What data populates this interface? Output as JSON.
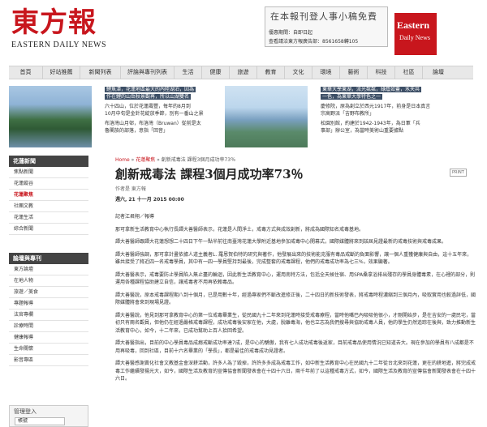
{
  "header": {
    "logo_cn": "東方報",
    "logo_en": "EASTERN DAILY NEWS",
    "ad_title": "在本報刊登人事小稿免費",
    "ad_line1": "優惠期間：自即日起",
    "ad_line2": "查看請洽東方報廣告部：8561658轉105",
    "badge_line1": "Eastern",
    "badge_line2": "Daily News"
  },
  "nav": [
    "首頁",
    "好站推薦",
    "新聞列表",
    "評論與專刊列表",
    "生活",
    "健康",
    "旅遊",
    "教育",
    "文化",
    "環境",
    "藝術",
    "科技",
    "社區",
    "論壇"
  ],
  "featured": [
    {
      "lines": [
        "鯉魚潭，花蓮地區最大的內陸湖泊，因為",
        "作在鯉的山岳秋景觀再，所以山湖雙名",
        "六十四山，位於花蓮壽豐，每年的8月到",
        "10月中旬是金針花綻放季節，別有一番山之景",
        "布洛灣山月邨，布洛灣（Bruwan）從前是太",
        "魯閣族的部落，意指「回音」"
      ]
    },
    {
      "lines": [
        "東華大學東湖，派光粼粼，綠蔭如蓋，水天共",
        "一色，為東華大學特色之一",
        "慶修院，原為創立於西元1917年，前身是日本真言",
        "宗高野派「吉野布教所」",
        "松園別館，約建於1942-1943年，為日軍「兵",
        "事部」辦公室，為當時美術山重要據點"
      ]
    }
  ],
  "sidebar": {
    "news_head": "花蓮新聞",
    "news_items": [
      "焦點新聞",
      "花蓮縱谷",
      "花蓮聚焦",
      "社團文教",
      "花蓮生活",
      "綜合新聞"
    ],
    "active_item": "花蓮聚焦",
    "column_head": "論壇與專刊",
    "column_items": [
      "東方論壇",
      "在地人物",
      "旅遊／美食",
      "專題報導",
      "法官專欄",
      "診療時間",
      "健康報導",
      "生命關懷",
      "影音專區"
    ],
    "login_title": "管理登入",
    "login_placeholder": "帳號"
  },
  "article": {
    "crumb_home": "Home",
    "crumb_sep1": "»",
    "crumb_section": "花蓮聚焦",
    "crumb_sep2": "»",
    "crumb_current": "創新戒毒法 課程3個月成功率73％",
    "title": "創新戒毒法 課程3個月成功率73％",
    "print_label": "PRINT",
    "author": "作者是 東方報",
    "date": "週六, 21 十一月 2015 00:00",
    "byline": "記者江君翔／報導",
    "paragraphs": [
      "那可拿新生活教育中心執行長譚大善醫師表示，花蓮是人間淨土，戒毒方式與成效創新，將成為國際知名戒毒基地。",
      "譚大善醫師跟譚大花蓮想想二十四日下午一點半前往南臺灣花蓮大學附近基地參加戒毒中心開幕式，國際媒體將來到該屆見證最新的戒毒技術與戒毒成果。",
      "譚大善醫師強調，那可拿計畫依據人道主義者L. 羅恩賀伯特的研究與著作，他發展出來的技術能克服有毒品戒斷的負面影響，讓一個人重獲健康與自由，這十五年來，雖共接受了將近四一名戒毒學員，其中有一四一學員堅持到最後，完成整套的戒毒課程，他們的戒毒成功率為七三%，效果顯著。",
      "譚大善醫表示，戒毒要防止學員陷入無止盡的輪迴，因此新生活教育中心，運用南特方法，包括全天候住宿、用SPA桑拿浴排出殘存的學員身體毒素，在心裡的部分，則運用各種課程協助建立自信，讓戒毒者不用再依賴毒品。",
      "譚大善醫說，原本戒毒課程期八到十個月，已是用數十年，經過專家們不斷改進修正後，二十四日的新技術發表，將戒毒時程濃縮到三個月內，吸取實用也較過詳低，國際媒體將會來到現場見證。",
      "譚大善醫說，他見到那可拿教育中心的第一位戒毒畢業生，從民國九十二年來到花蓮時接受戒毒療程，當時他嘴巴內吸吸他很小，才剛開始步，是在吉安的一處民宅，當初只有兩名觀員，但他仍在經過嚴格戒毒課程，成功戒毒後安家在他，大處，脫離毒海，他也立志為我們搜尋與協助戒毒人員，他的學生仍然追踪在後與，致力推動新生活教育中心，如今，十二年來，已成功幫助上百人拾回希望。",
      "譚大善醫指出，目前的中心學員毒品成癮戒斷成功率達7成，是中心的驕傲，我有七人成功戒毒後返家，目前戒毒品使用情況已知道去大。現在參加的學員有八成都是不用再吸毒，回到社區，目前十六名畢業的「學長」，都是最佳的戒毒成功見證者。",
      "譚大善醫感謝黃化社會文教基金會深耕活動，許多人為了毀掉，許許多多成為戒毒工作，如中新生活教育中心在民國九十二年從台北來到花蓮，更在的耕地進，將完成戒毒工作繼續發揚光大，如今，國際生活及教育的宣傳協會新聞發表會在十四十六日，兩千年前了以這種戒毒方式，如今，國際生活及教育的宣傳協會新聞發表會在十四十六日。"
    ]
  }
}
